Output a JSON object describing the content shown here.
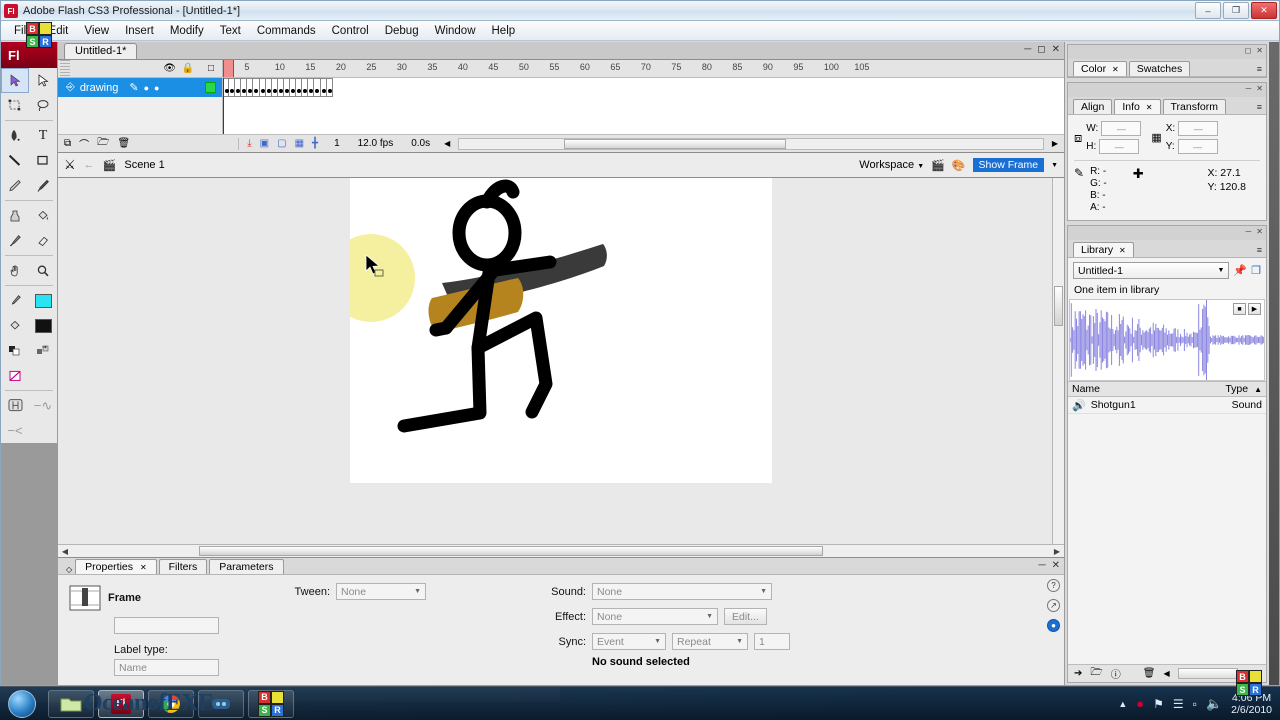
{
  "window": {
    "title": "Adobe Flash CS3 Professional - [Untitled-1*]",
    "app_icon": "FL",
    "minimize": "–",
    "maximize": "❐",
    "close": "✕"
  },
  "menubar": {
    "items": [
      "File",
      "Edit",
      "View",
      "Insert",
      "Modify",
      "Text",
      "Commands",
      "Control",
      "Debug",
      "Window",
      "Help"
    ]
  },
  "toolbox": {
    "logo": "Fl",
    "tools": [
      {
        "name": "selection-tool",
        "glyph": "➤",
        "selected": true
      },
      {
        "name": "subselection-tool",
        "glyph": "➤",
        "selected": false
      },
      {
        "name": "free-transform-tool",
        "glyph": "⬚",
        "selected": false
      },
      {
        "name": "lasso-tool",
        "glyph": "⌒",
        "selected": false
      },
      {
        "name": "pen-tool",
        "glyph": "✒",
        "selected": false
      },
      {
        "name": "text-tool",
        "glyph": "T",
        "selected": false
      },
      {
        "name": "line-tool",
        "glyph": "╲",
        "selected": false
      },
      {
        "name": "rectangle-tool",
        "glyph": "□",
        "selected": false
      },
      {
        "name": "pencil-tool",
        "glyph": "✎",
        "selected": false
      },
      {
        "name": "brush-tool",
        "glyph": "✐",
        "selected": false
      },
      {
        "name": "ink-bottle-tool",
        "glyph": "◔",
        "selected": false
      },
      {
        "name": "paint-bucket-tool",
        "glyph": "◕",
        "selected": false
      },
      {
        "name": "eyedropper-tool",
        "glyph": "⚗",
        "selected": false
      },
      {
        "name": "eraser-tool",
        "glyph": "▱",
        "selected": false
      },
      {
        "name": "hand-tool",
        "glyph": "✋",
        "selected": false
      },
      {
        "name": "zoom-tool",
        "glyph": "⌕",
        "selected": false
      }
    ],
    "stroke_color": "#000000",
    "fill_color": "#29e3f2"
  },
  "document": {
    "tab_label": "Untitled-1*"
  },
  "timeline": {
    "layer_header_icons": [
      "eye-icon",
      "lock-icon",
      "outline-icon"
    ],
    "layers": [
      {
        "name": "drawing",
        "selected": true,
        "color": "#28d84a"
      }
    ],
    "ruler_ticks": [
      5,
      10,
      15,
      20,
      25,
      30,
      35,
      40,
      45,
      50,
      55,
      60,
      65,
      70,
      75,
      80,
      85,
      90,
      95,
      100,
      105
    ],
    "keyframe_count": 18,
    "current_frame": "1",
    "fps": "12.0 fps",
    "elapsed": "0.0s",
    "foot_icons": [
      "new-layer-icon",
      "add-motion-guide-icon",
      "new-folder-icon",
      "delete-layer-icon",
      "center-frame-icon",
      "onion-skin-icon",
      "onion-skin-outlines-icon",
      "edit-multiple-frames-icon",
      "modify-onion-markers-icon"
    ]
  },
  "scenebar": {
    "edit_scene_icon": "edit-scene-icon",
    "back_icon": "back-arrow-icon",
    "scene_icon": "scene-icon",
    "scene_label": "Scene 1",
    "workspace_label": "Workspace",
    "edit_scene_menu_icon": "edit-scene-menu-icon",
    "edit_symbols_icon": "edit-symbols-icon",
    "zoom_value": "Show Frame"
  },
  "stage": {
    "artwork_name": "stick-figure-with-shotgun",
    "muzzle_flash_color": "#f5f0a0",
    "gun_barrel_color": "#3a3a3a",
    "gun_stock_color": "#b5841f",
    "figure_color": "#000000",
    "cursor": "arrow-cursor"
  },
  "properties": {
    "tabs": [
      {
        "label": "Properties",
        "active": true,
        "closable": true
      },
      {
        "label": "Filters",
        "active": false,
        "closable": false
      },
      {
        "label": "Parameters",
        "active": false,
        "closable": false
      }
    ],
    "frame_label": "Frame",
    "frame_name_value": "",
    "label_type_label": "Label type:",
    "label_type_value": "Name",
    "tween_label": "Tween:",
    "tween_value": "None",
    "sound_label": "Sound:",
    "sound_value": "None",
    "effect_label": "Effect:",
    "effect_value": "None",
    "edit_button": "Edit...",
    "sync_label": "Sync:",
    "sync_value": "Event",
    "repeat_value": "Repeat",
    "loop_count": "1",
    "status": "No sound selected",
    "side_icons": [
      "help-icon",
      "share-icon",
      "accessibility-icon"
    ]
  },
  "dock": {
    "color_panel": {
      "tabs": [
        {
          "label": "Color",
          "active": true,
          "closable": true
        },
        {
          "label": "Swatches",
          "active": false,
          "closable": false
        }
      ]
    },
    "info_panel": {
      "tabs": [
        {
          "label": "Align",
          "active": false,
          "closable": false
        },
        {
          "label": "Info",
          "active": true,
          "closable": true
        },
        {
          "label": "Transform",
          "active": false,
          "closable": false
        }
      ],
      "w_label": "W:",
      "w_value": "—",
      "h_label": "H:",
      "h_value": "—",
      "x_label": "X:",
      "x_value": "—",
      "y_label": "Y:",
      "y_value": "—",
      "r_label": "R:",
      "r_value": "-",
      "g_label": "G:",
      "g_value": "-",
      "b_label": "B:",
      "b_value": "-",
      "a_label": "A:",
      "a_value": "-",
      "cursor_x_label": "X:",
      "cursor_x_value": "27.1",
      "cursor_y_label": "Y:",
      "cursor_y_value": "120.8"
    },
    "library_panel": {
      "tabs": [
        {
          "label": "Library",
          "active": true,
          "closable": true
        }
      ],
      "document_name": "Untitled-1",
      "item_count_text": "One item in library",
      "col_name": "Name",
      "col_type": "Type",
      "items": [
        {
          "name": "Shotgun1",
          "type": "Sound",
          "icon": "sound-icon"
        }
      ],
      "foot_icons": [
        "new-symbol-icon",
        "new-folder-icon",
        "properties-icon",
        "delete-icon"
      ]
    }
  },
  "taskbar": {
    "start_button": "start-orb",
    "watermark": "OceanofEXE",
    "buttons": [
      {
        "name": "taskbar-explorer",
        "icon": "folder-icon",
        "active": false
      },
      {
        "name": "taskbar-flash",
        "icon": "flash-icon",
        "active": true
      },
      {
        "name": "taskbar-chrome",
        "icon": "chrome-icon",
        "active": false
      },
      {
        "name": "taskbar-media",
        "icon": "media-icon",
        "active": false
      },
      {
        "name": "taskbar-bsr",
        "icon": "bsr-icon",
        "active": false
      }
    ],
    "tray_icons": [
      "show-hidden-icon",
      "bsr-record-icon",
      "network-icon",
      "signal-icon",
      "battery-icon",
      "volume-icon"
    ],
    "clock_time": "4:06 PM",
    "clock_date": "2/6/2010"
  },
  "overlay": {
    "bsr_blocks": [
      {
        "letter": "B",
        "color": "#d83030"
      },
      {
        "letter": "",
        "color": "#e8e038"
      },
      {
        "letter": "S",
        "color": "#3ab54a"
      },
      {
        "letter": "R",
        "color": "#2a72d8"
      }
    ]
  }
}
